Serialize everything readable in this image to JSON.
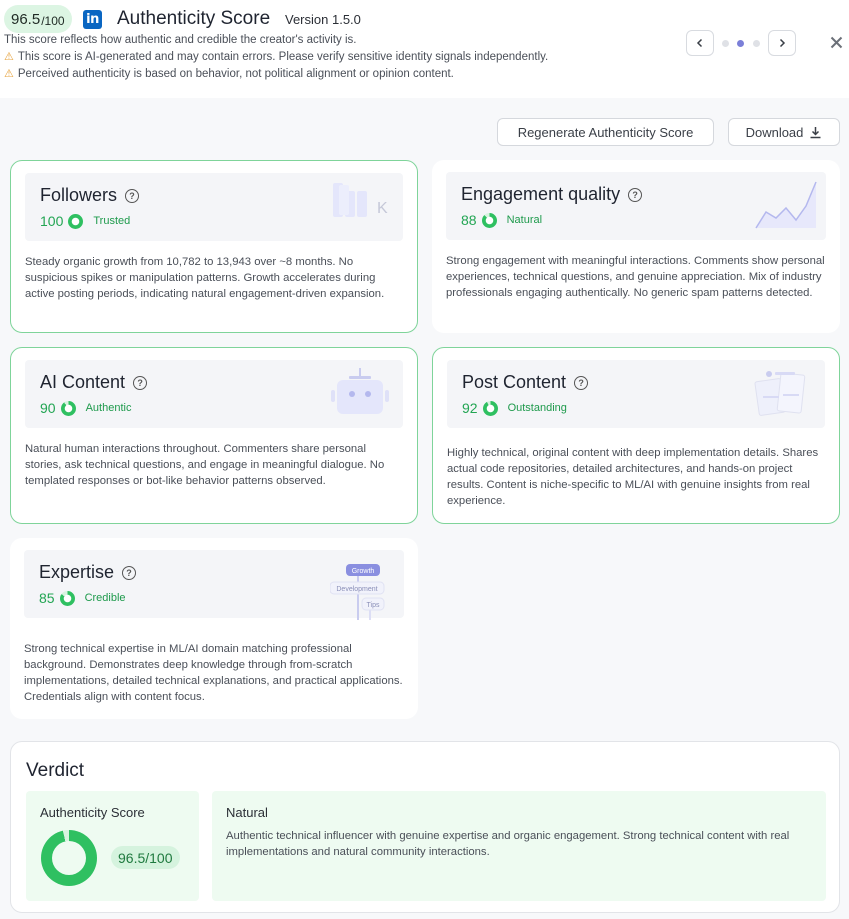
{
  "header": {
    "score": "96.5",
    "score_den": "/100",
    "logo": "in",
    "title": "Authenticity Score",
    "version": "Version 1.5.0",
    "description": "This score reflects how authentic and credible the creator's activity is.",
    "warnings": [
      "This score is AI-generated and may contain errors. Please verify sensitive identity signals independently.",
      "Perceived authenticity is based on behavior, not political alignment or opinion content."
    ],
    "prev_icon": "chevron-left-icon",
    "next_icon": "chevron-right-icon",
    "close_icon": "close-icon",
    "page_count": 3,
    "active_page": 2
  },
  "actions": {
    "regenerate_label": "Regenerate Authenticity Score",
    "download_label": "Download",
    "download_icon": "download-icon"
  },
  "cards": [
    {
      "title": "Followers",
      "score": "100",
      "status": "Trusted",
      "score_fraction": 1.0,
      "body": "Steady organic growth from 10,782 to 13,943 over ~8 months. No suspicious spikes or manipulation patterns. Growth accelerates during active posting periods, indicating natural engagement-driven expansion.",
      "illus_text": "K"
    },
    {
      "title": "Engagement quality",
      "score": "88",
      "status": "Natural",
      "score_fraction": 0.88,
      "body": "Strong engagement with meaningful interactions. Comments show personal experiences, technical questions, and genuine appreciation. Mix of industry professionals engaging authentically. No generic spam patterns detected."
    },
    {
      "title": "AI Content",
      "score": "90",
      "status": "Authentic",
      "score_fraction": 0.9,
      "body": "Natural human interactions throughout. Commenters share personal stories, ask technical questions, and engage in meaningful dialogue. No templated responses or bot-like behavior patterns observed."
    },
    {
      "title": "Post Content",
      "score": "92",
      "status": "Outstanding",
      "score_fraction": 0.92,
      "body": "Highly technical, original content with deep implementation details. Shares actual code repositories, detailed architectures, and hands-on project results. Content is niche-specific to ML/AI with genuine insights from real experience."
    },
    {
      "title": "Expertise",
      "score": "85",
      "status": "Credible",
      "score_fraction": 0.85,
      "body": "Strong technical expertise in ML/AI domain matching professional background. Demonstrates deep knowledge through from-scratch implementations, detailed technical explanations, and practical applications. Credentials align with content focus.",
      "tags": [
        "Growth",
        "Development",
        "Tips"
      ]
    }
  ],
  "verdict": {
    "title": "Verdict",
    "score_label": "Authenticity Score",
    "score_value": "96.5/100",
    "score_fraction": 0.965,
    "natural_label": "Natural",
    "natural_text": "Authentic technical influencer with genuine expertise and organic engagement. Strong technical content with real implementations and natural community interactions."
  },
  "colors": {
    "accent_green": "#2fc061",
    "card_border": "#7fd49a",
    "dot_active": "#7b7fd8",
    "linkedin": "#0a66c2"
  }
}
